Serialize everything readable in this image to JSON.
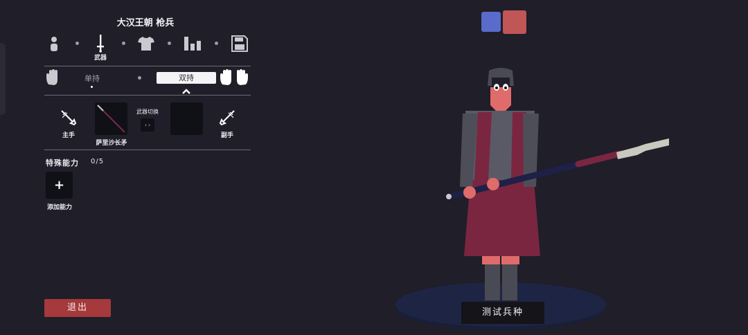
{
  "unit_title": "大汉王朝 枪兵",
  "categories": [
    {
      "id": "body",
      "icon": "person-icon",
      "label": ""
    },
    {
      "id": "weapon",
      "icon": "sword-icon",
      "label": "武器"
    },
    {
      "id": "armor",
      "icon": "shirt-icon",
      "label": ""
    },
    {
      "id": "stats",
      "icon": "bar-chart-icon",
      "label": ""
    },
    {
      "id": "save",
      "icon": "save-icon",
      "label": ""
    }
  ],
  "grip": {
    "single": "单持",
    "double": "双持",
    "selected": "double"
  },
  "weapons": {
    "main_hand_label": "主手",
    "off_hand_label": "副手",
    "main_weapon_name": "萨里沙长矛",
    "switch_label": "武器切换",
    "switch_icon_text": "‹ ›"
  },
  "abilities": {
    "label": "特殊能力",
    "count": "0/5",
    "add_label": "添加能力",
    "add_symbol": "+"
  },
  "exit_label": "退出",
  "test_label": "测试兵种",
  "colors": {
    "background": "#1f1e29",
    "team_blue": "#5a6bcc",
    "team_red": "#c05656",
    "exit": "#a5393b"
  }
}
